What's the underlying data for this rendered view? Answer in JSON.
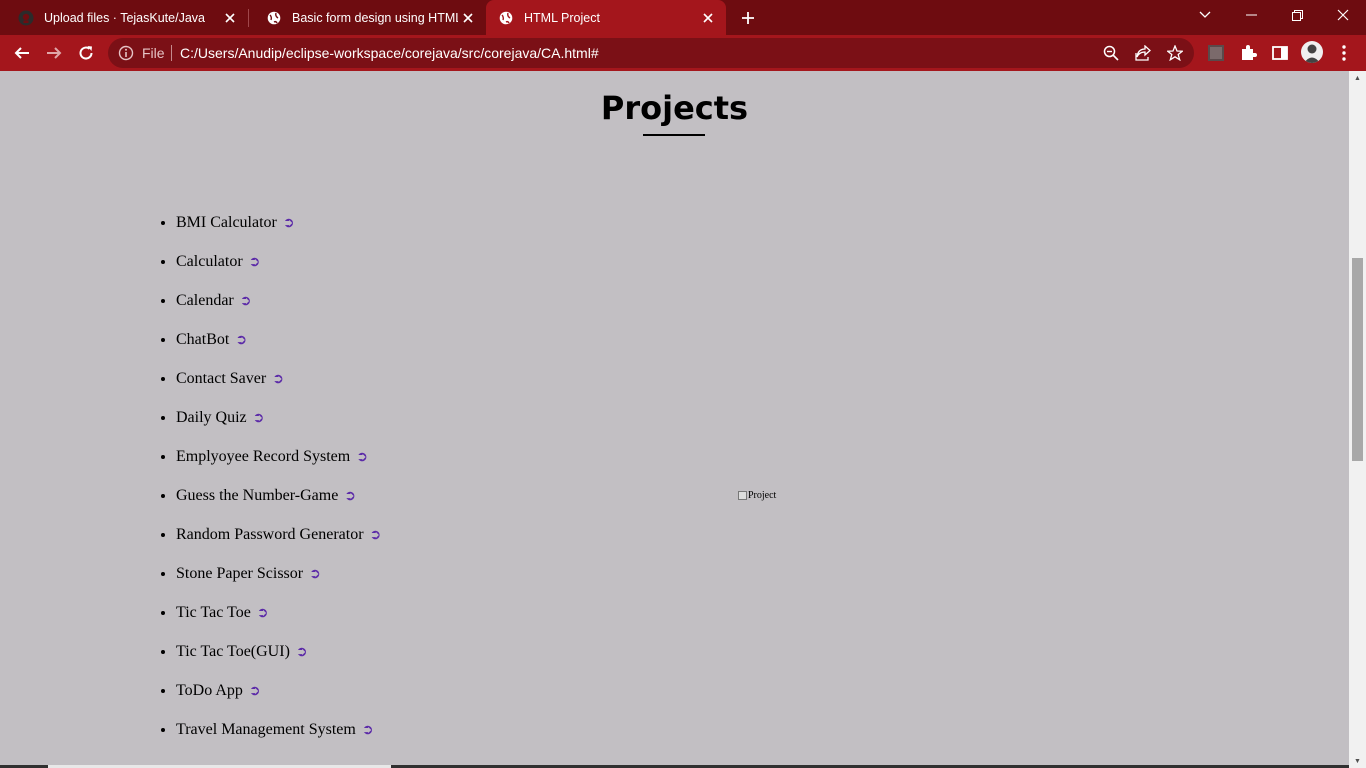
{
  "browser": {
    "tabs": [
      {
        "title": "Upload files · TejasKute/Java",
        "favicon": "github-icon",
        "active": false
      },
      {
        "title": "Basic form design using HTML",
        "favicon": "globe-icon",
        "active": false
      },
      {
        "title": "HTML Project",
        "favicon": "globe-icon",
        "active": true
      }
    ],
    "address": {
      "scheme_label": "File",
      "url": "C:/Users/Anudip/eclipse-workspace/corejava/src/corejava/CA.html#"
    },
    "colors": {
      "frame": "#6e0c10",
      "toolbar": "#a4161c",
      "omnibox": "#7b1016"
    }
  },
  "page": {
    "heading": "Projects",
    "projects": [
      "BMI Calculator",
      "Calculator",
      "Calendar",
      "ChatBot",
      "Contact Saver",
      "Daily Quiz",
      "Emplyoyee Record System",
      "Guess the Number-Game",
      "Random Password Generator",
      "Stone Paper Scissor",
      "Tic Tac Toe",
      "Tic Tac Toe(GUI)",
      "ToDo App",
      "Travel Management System"
    ],
    "link_arrow": "➲",
    "image_alt": "Project",
    "background": "#c2bfc3",
    "arrow_color": "#5b2aa8"
  }
}
